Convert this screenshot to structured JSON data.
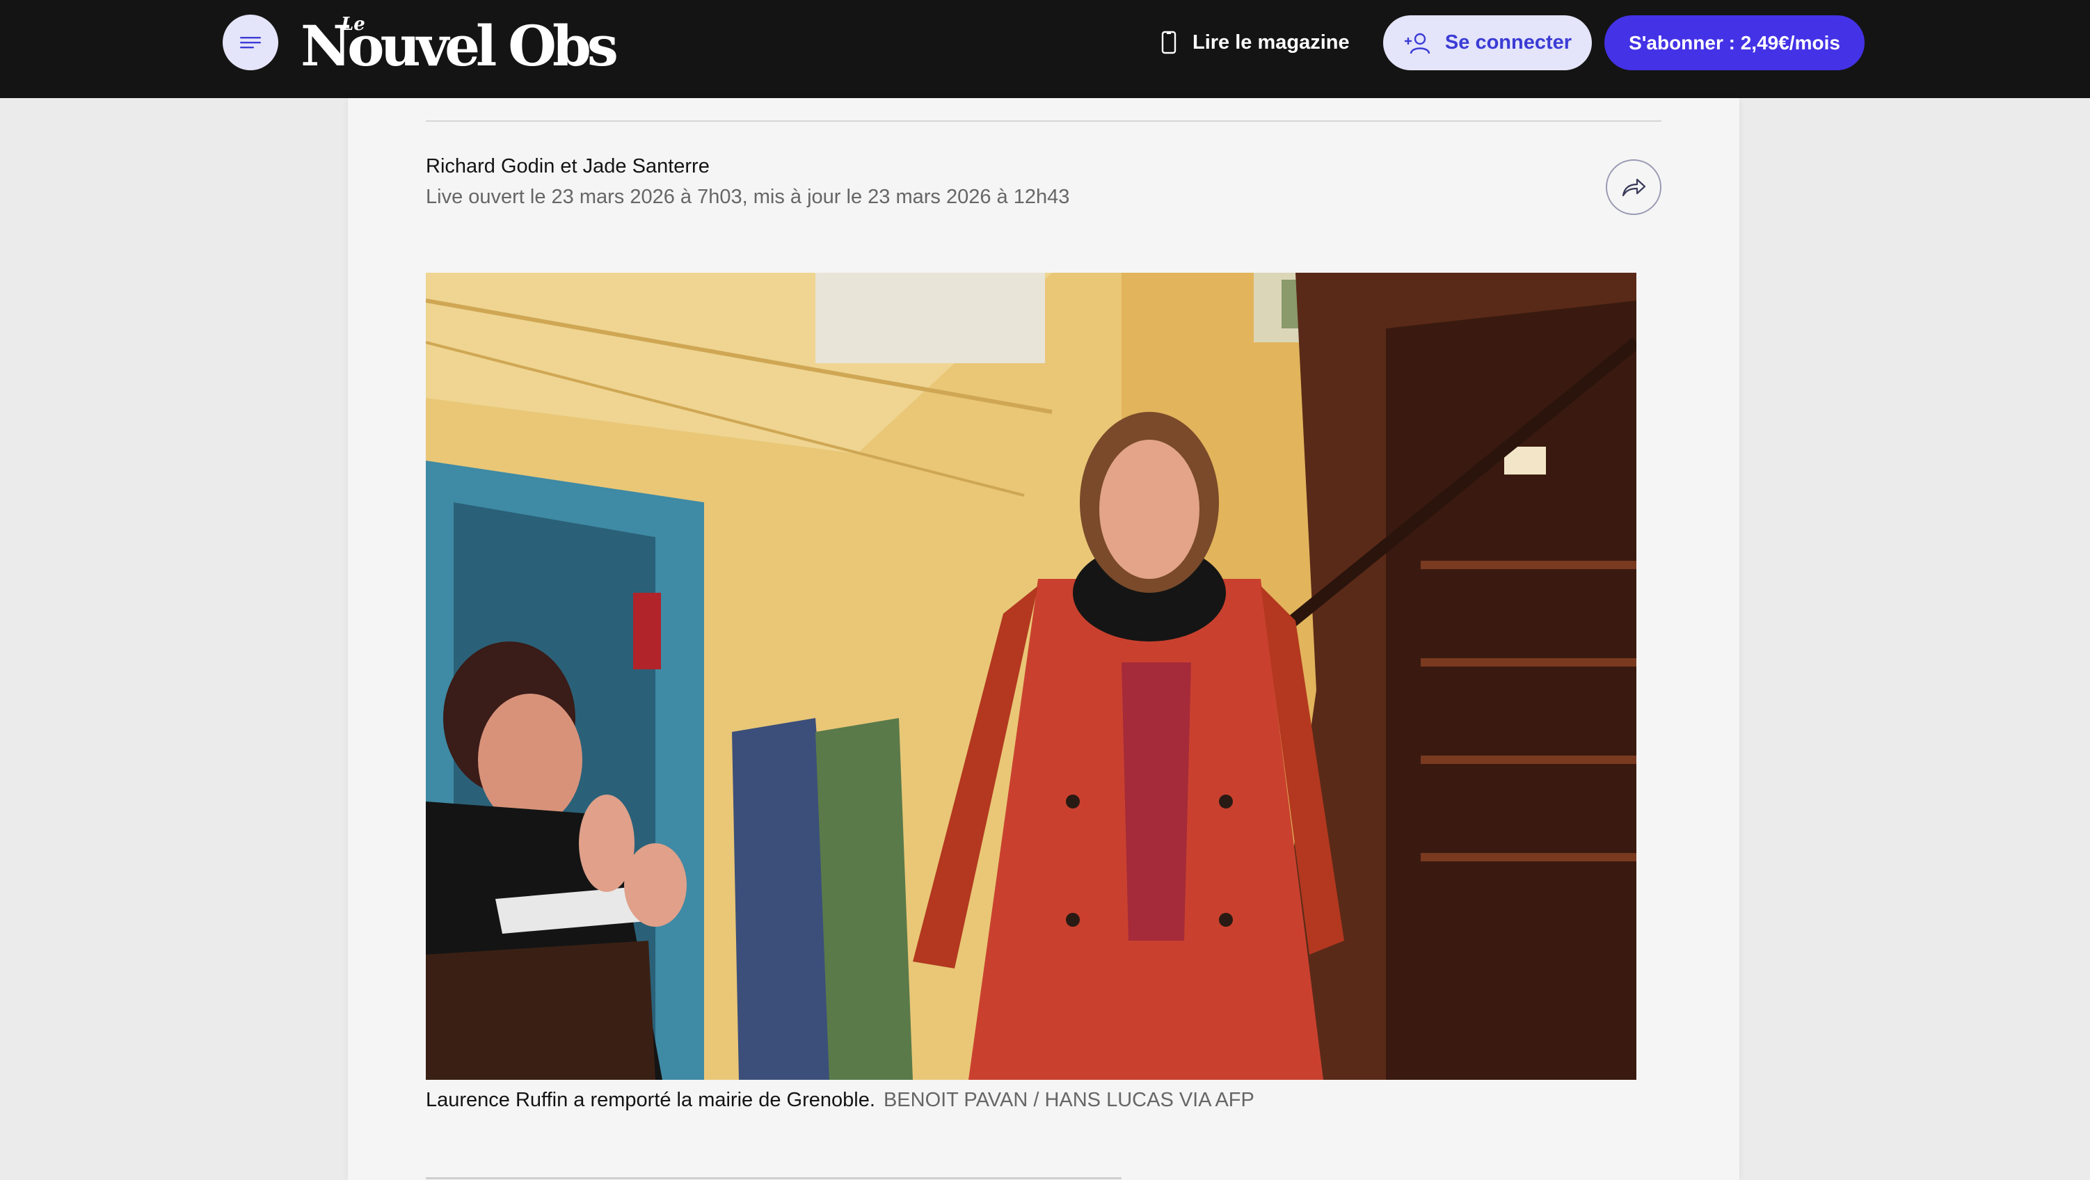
{
  "header": {
    "menu_icon": "hamburger-menu-icon",
    "logo_small": "Le",
    "logo_main": "Nouvel Obs",
    "magazine_icon": "smartphone-icon",
    "magazine_label": "Lire le magazine",
    "login_icon": "user-add-icon",
    "login_label": "Se connecter",
    "subscribe_label": "S'abonner : 2,49€/mois"
  },
  "article": {
    "authors": "Richard Godin et Jade Santerre",
    "dateline": "Live ouvert le 23 mars 2026 à 7h03, mis à jour le 23 mars 2026 à 12h43",
    "share_icon": "share-arrow-icon",
    "photo_caption": "Laurence Ruffin a remporté la mairie de Grenoble.",
    "photo_credit": "BENOIT PAVAN / HANS LUCAS VIA AFP"
  },
  "colors": {
    "topbar": "#141414",
    "accent": "#4432e6",
    "login_bg": "#e4e4fa",
    "page_bg": "#ebebeb",
    "card_bg": "#f5f5f5"
  }
}
